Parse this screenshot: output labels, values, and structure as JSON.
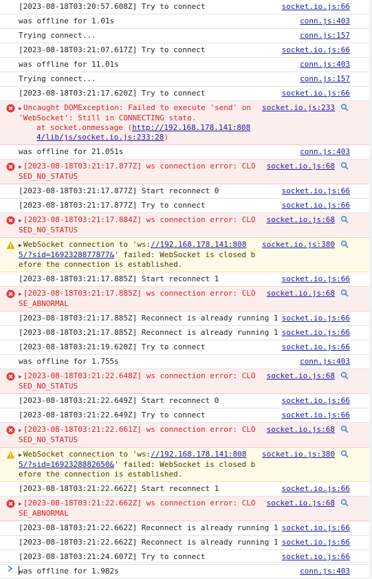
{
  "colors": {
    "error_bg": "#fdeeee",
    "error_text": "#d32222",
    "warning_bg": "#fffbe6",
    "link": "#1a1aa6"
  },
  "icons": {
    "error": "error-circle-icon",
    "warning": "warning-triangle-icon",
    "expand": "expand-triangle-icon",
    "search": "search-icon",
    "prompt": "prompt-chevron-icon"
  },
  "messages": [
    {
      "level": "info",
      "text": "[2023-08-18T03:20:57.608Z] Try to connect",
      "source": "socket.io.js:66"
    },
    {
      "level": "info",
      "text": "was offline for 1.01s",
      "source": "conn.js:403"
    },
    {
      "level": "info",
      "text": "Trying connect...",
      "source": "conn.js:157"
    },
    {
      "level": "info",
      "text": "[2023-08-18T03:21:07.617Z] Try to connect",
      "source": "socket.io.js:66"
    },
    {
      "level": "info",
      "text": "was offline for 11.01s",
      "source": "conn.js:403"
    },
    {
      "level": "info",
      "text": "Trying connect...",
      "source": "conn.js:157"
    },
    {
      "level": "info",
      "text": "[2023-08-18T03:21:17.620Z] Try to connect",
      "source": "socket.io.js:66"
    },
    {
      "level": "error",
      "text": "Uncaught DOMException: Failed to execute 'send' on 'WebSocket': Still in CONNECTING state.",
      "source": "socket.io.js:233",
      "stack_prefix": "at socket.onmessage (",
      "stack_link": "http://192.168.178.141:8084/lib/js/socket.io.js:233:28",
      "stack_suffix": ")"
    },
    {
      "level": "info",
      "text": "was offline for 21.051s",
      "source": "conn.js:403"
    },
    {
      "level": "error",
      "text": "[2023-08-18T03:21:17.877Z] ws connection error: CLOSED_NO_STATUS",
      "source": "socket.io.js:68"
    },
    {
      "level": "info",
      "text": "[2023-08-18T03:21:17.877Z] Start reconnect 0",
      "source": "socket.io.js:66"
    },
    {
      "level": "info",
      "text": "[2023-08-18T03:21:17.877Z] Try to connect",
      "source": "socket.io.js:66"
    },
    {
      "level": "error",
      "text": "[2023-08-18T03:21:17.884Z] ws connection error: CLOSED_NO_STATUS",
      "source": "socket.io.js:68"
    },
    {
      "level": "warning",
      "text_prefix": "WebSocket connection to 'ws:",
      "text_link": "//192.168.178.141:8085/?sid=1692328877877&",
      "text_suffix": "' failed: WebSocket is closed before the connection is established.",
      "source": "socket.io.js:380"
    },
    {
      "level": "info",
      "text": "[2023-08-18T03:21:17.885Z] Start reconnect 1",
      "source": "socket.io.js:66"
    },
    {
      "level": "error",
      "text": "[2023-08-18T03:21:17.885Z] ws connection error: CLOSE_ABNORMAL",
      "source": "socket.io.js:68"
    },
    {
      "level": "info",
      "text": "[2023-08-18T03:21:17.885Z] Reconnect is already running 1",
      "source": "socket.io.js:66"
    },
    {
      "level": "info",
      "text": "[2023-08-18T03:21:17.885Z] Reconnect is already running 1",
      "source": "socket.io.js:66"
    },
    {
      "level": "info",
      "text": "[2023-08-18T03:21:19.620Z] Try to connect",
      "source": "socket.io.js:66"
    },
    {
      "level": "info",
      "text": "was offline for 1.755s",
      "source": "conn.js:403"
    },
    {
      "level": "error",
      "text": "[2023-08-18T03:21:22.648Z] ws connection error: CLOSED_NO_STATUS",
      "source": "socket.io.js:68"
    },
    {
      "level": "info",
      "text": "[2023-08-18T03:21:22.649Z] Start reconnect 0",
      "source": "socket.io.js:66"
    },
    {
      "level": "info",
      "text": "[2023-08-18T03:21:22.649Z] Try to connect",
      "source": "socket.io.js:66"
    },
    {
      "level": "error",
      "text": "[2023-08-18T03:21:22.661Z] ws connection error: CLOSED_NO_STATUS",
      "source": "socket.io.js:68"
    },
    {
      "level": "warning",
      "text_prefix": "WebSocket connection to 'ws:",
      "text_link": "//192.168.178.141:8085/?sid=1692328882650&",
      "text_suffix": "' failed: WebSocket is closed before the connection is established.",
      "source": "socket.io.js:380"
    },
    {
      "level": "info",
      "text": "[2023-08-18T03:21:22.662Z] Start reconnect 1",
      "source": "socket.io.js:66"
    },
    {
      "level": "error",
      "text": "[2023-08-18T03:21:22.662Z] ws connection error: CLOSE_ABNORMAL",
      "source": "socket.io.js:68"
    },
    {
      "level": "info",
      "text": "[2023-08-18T03:21:22.662Z] Reconnect is already running 1",
      "source": "socket.io.js:66"
    },
    {
      "level": "info",
      "text": "[2023-08-18T03:21:22.662Z] Reconnect is already running 1",
      "source": "socket.io.js:66"
    },
    {
      "level": "info",
      "text": "[2023-08-18T03:21:24.607Z] Try to connect",
      "source": "socket.io.js:66"
    },
    {
      "level": "info",
      "text": "was offline for 1.982s",
      "source": "conn.js:403"
    }
  ]
}
